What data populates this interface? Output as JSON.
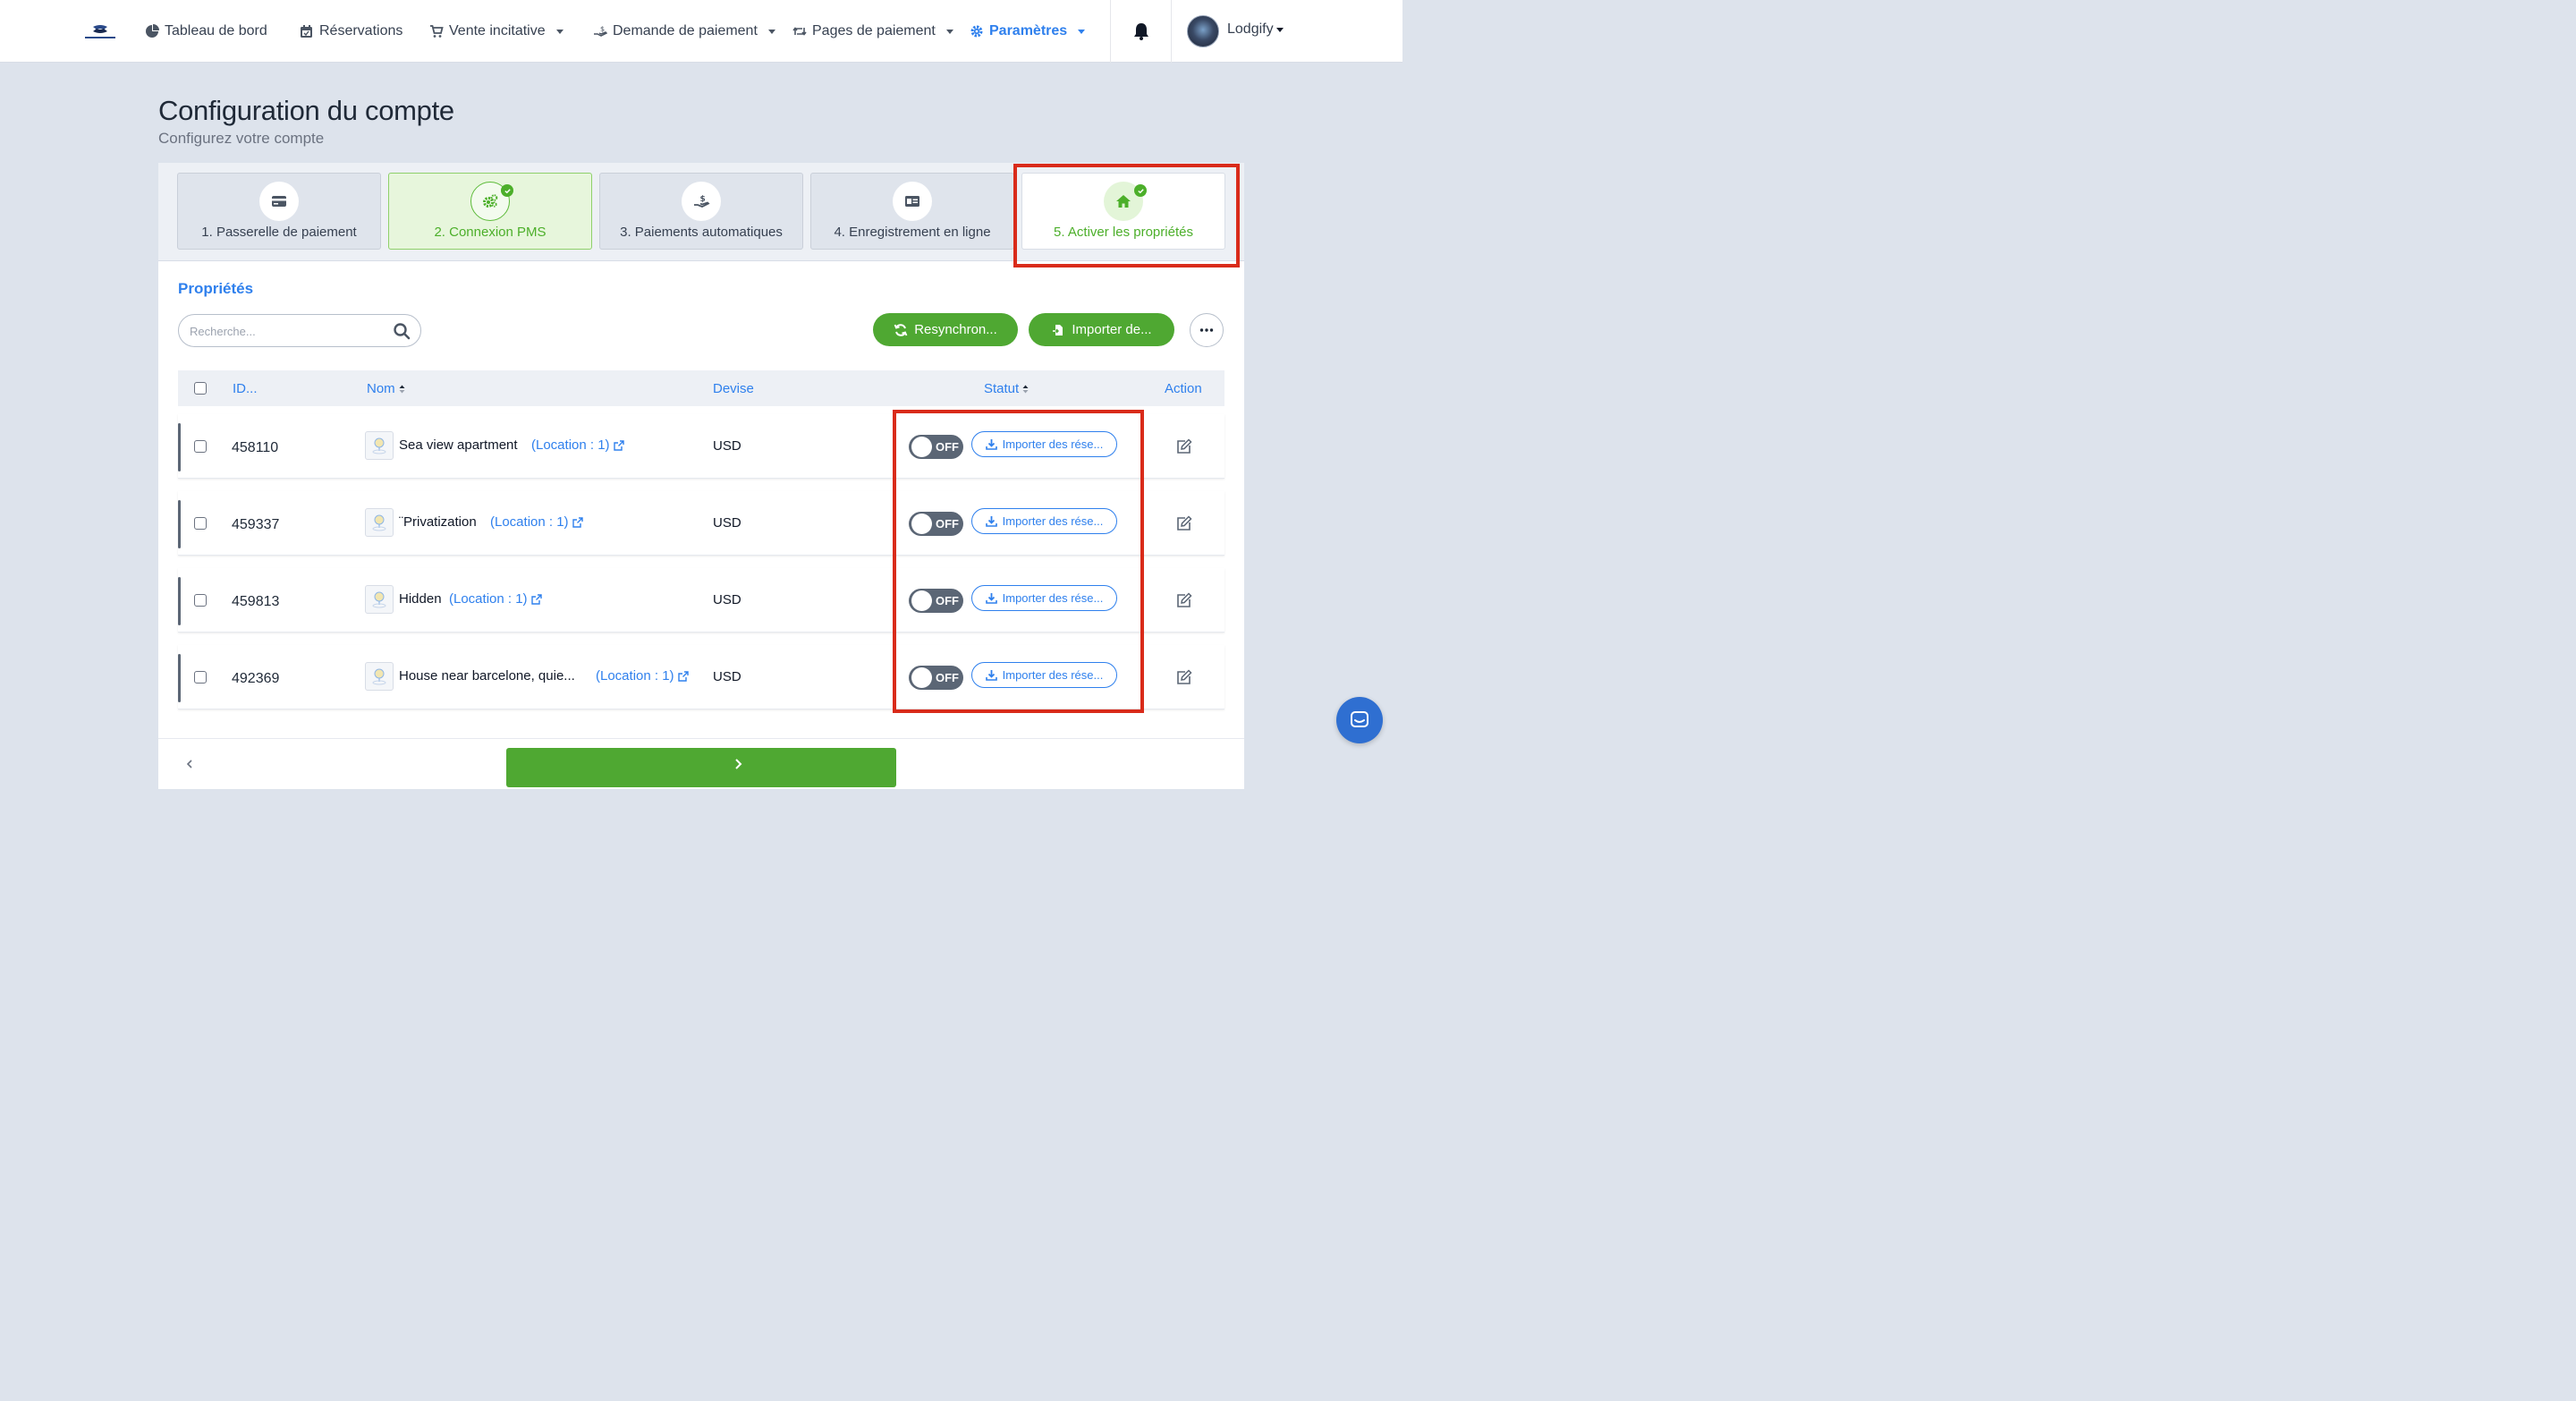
{
  "nav": {
    "items": [
      {
        "label": "Tableau de bord",
        "icon": "dashboard-icon",
        "dropdown": false
      },
      {
        "label": "Réservations",
        "icon": "calendar-icon",
        "dropdown": false
      },
      {
        "label": "Vente incitative",
        "icon": "cart-icon",
        "dropdown": true
      },
      {
        "label": "Demande de paiement",
        "icon": "payment-hand-icon",
        "dropdown": true
      },
      {
        "label": "Pages de paiement",
        "icon": "retweet-icon",
        "dropdown": true
      },
      {
        "label": "Paramètres",
        "icon": "gear-icon",
        "dropdown": true,
        "active": true
      }
    ],
    "user": "Lodgify"
  },
  "header": {
    "title": "Configuration du compte",
    "subtitle": "Configurez votre compte"
  },
  "steps": [
    {
      "label": "1. Passerelle de paiement",
      "icon": "credit-card-icon",
      "state": "default"
    },
    {
      "label": "2. Connexion PMS",
      "icon": "cogs-icon",
      "state": "done"
    },
    {
      "label": "3. Paiements automatiques",
      "icon": "hand-dollar-icon",
      "state": "default"
    },
    {
      "label": "4. Enregistrement en ligne",
      "icon": "id-card-icon",
      "state": "default"
    },
    {
      "label": "5. Activer les propriétés",
      "icon": "home-icon",
      "state": "current"
    }
  ],
  "properties": {
    "title": "Propriétés",
    "search_placeholder": "Recherche...",
    "resync_label": "Resynchron...",
    "import_label": "Importer de...",
    "columns": {
      "id": "ID...",
      "name": "Nom",
      "currency": "Devise",
      "status": "Statut",
      "action": "Action"
    },
    "rows": [
      {
        "id": "458110",
        "name": "Sea view apartment",
        "location": "(Location : 1)",
        "currency": "USD",
        "status": "OFF",
        "import": "Importer des rése..."
      },
      {
        "id": "459337",
        "name": "¨Privatization",
        "location": "(Location : 1)",
        "currency": "USD",
        "status": "OFF",
        "import": "Importer des rése..."
      },
      {
        "id": "459813",
        "name": "Hidden",
        "location": "(Location : 1)",
        "currency": "USD",
        "status": "OFF",
        "import": "Importer des rése..."
      },
      {
        "id": "492369",
        "name": "House near barcelone, quie...",
        "location": "(Location : 1)",
        "currency": "USD",
        "status": "OFF",
        "import": "Importer des rése..."
      }
    ]
  },
  "colors": {
    "accent": "#2f80ed",
    "success": "#4fa832",
    "highlight": "#d92b1a"
  }
}
